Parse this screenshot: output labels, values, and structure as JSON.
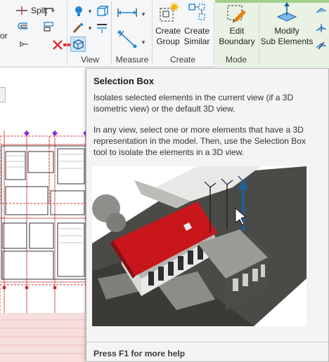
{
  "ribbon": {
    "left_cut_label": "or",
    "split_label": "Split",
    "panels": {
      "view": "View",
      "measure": "Measure",
      "create": "Create",
      "mode": "Mode"
    },
    "buttons": {
      "create_group": [
        "Create",
        "Group"
      ],
      "create_similar": [
        "Create",
        "Similar"
      ],
      "edit_boundary": [
        "Edit",
        "Boundary"
      ],
      "modify_sub_elements": [
        "Modify",
        "Sub Elements"
      ]
    },
    "colors": {
      "mode_accent": "#9fd08a",
      "icon_blue": "#1e88d8",
      "icon_red": "#e03030"
    }
  },
  "tooltip": {
    "title": "Selection Box",
    "description": "Isolates selected elements in the current view (if a 3D isometric view) or the default 3D view.",
    "detail": "In any view, select one or more elements that have a 3D representation in the model. Then, use the Selection Box tool to isolate the elements in a 3D view.",
    "help": "Press F1 for more help"
  }
}
